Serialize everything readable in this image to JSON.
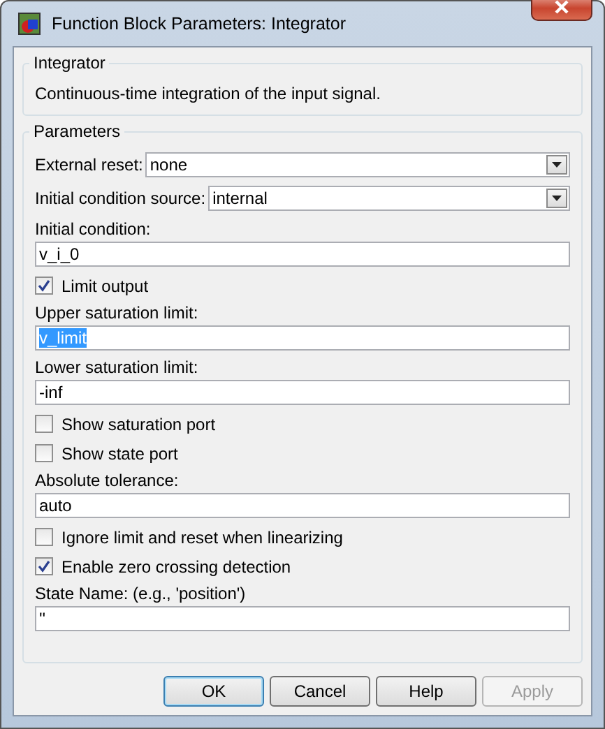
{
  "window": {
    "title": "Function Block Parameters: Integrator"
  },
  "description_group": {
    "title": "Integrator",
    "text": "Continuous-time integration of the input signal."
  },
  "parameters_group": {
    "title": "Parameters",
    "items": [
      {
        "kind": "dropdown",
        "label": "External reset:",
        "value": "none"
      },
      {
        "kind": "dropdown",
        "label": "Initial condition source:",
        "value": "internal"
      },
      {
        "kind": "text",
        "label": "Initial condition:",
        "value": "v_i_0",
        "highlighted": false
      },
      {
        "kind": "checkbox",
        "label": "Limit output",
        "checked": true
      },
      {
        "kind": "text",
        "label": "Upper saturation limit:",
        "value": "v_limit",
        "highlighted": true
      },
      {
        "kind": "text",
        "label": "Lower saturation limit:",
        "value": "-inf",
        "highlighted": false
      },
      {
        "kind": "checkbox",
        "label": "Show saturation port",
        "checked": false
      },
      {
        "kind": "checkbox",
        "label": "Show state port",
        "checked": false
      },
      {
        "kind": "text",
        "label": "Absolute tolerance:",
        "value": "auto",
        "highlighted": false
      },
      {
        "kind": "checkbox",
        "label": "Ignore limit and reset when linearizing",
        "checked": false
      },
      {
        "kind": "checkbox",
        "label": "Enable zero crossing detection",
        "checked": true
      },
      {
        "kind": "text",
        "label": "State Name: (e.g., 'position')",
        "value": "''",
        "highlighted": false
      }
    ]
  },
  "buttons": [
    {
      "label": "OK",
      "default": true,
      "disabled": false
    },
    {
      "label": "Cancel",
      "default": false,
      "disabled": false
    },
    {
      "label": "Help",
      "default": false,
      "disabled": false
    },
    {
      "label": "Apply",
      "default": false,
      "disabled": true
    }
  ]
}
